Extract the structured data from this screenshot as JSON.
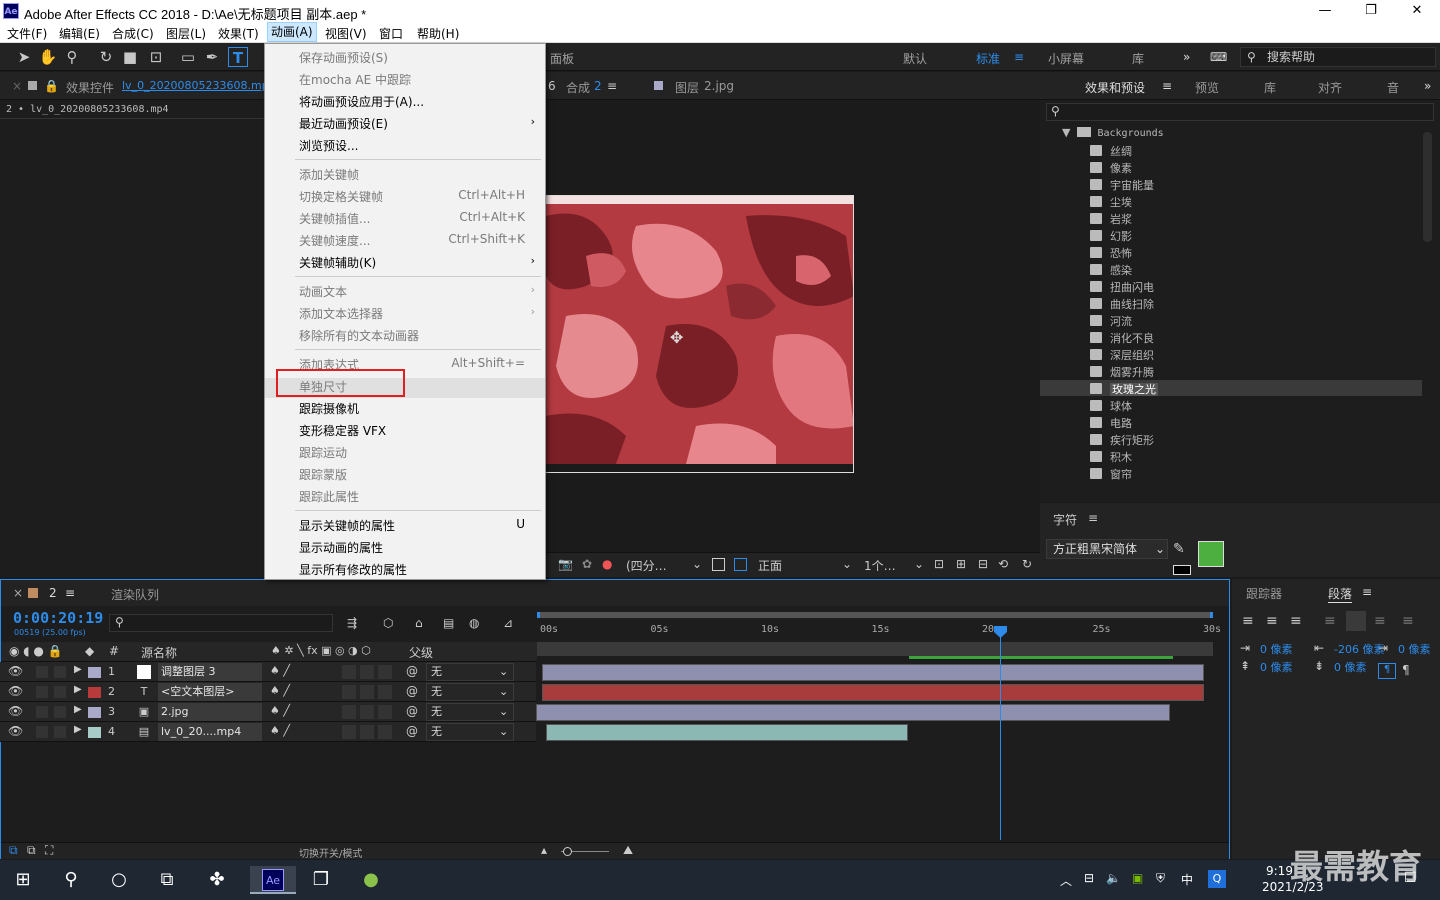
{
  "window": {
    "title": "Adobe After Effects CC 2018 - D:\\Ae\\无标题项目 副本.aep *",
    "app_icon": "Ae",
    "controls": [
      "—",
      "❐",
      "✕"
    ]
  },
  "menubar": {
    "items": [
      "文件(F)",
      "编辑(E)",
      "合成(C)",
      "图层(L)",
      "效果(T)",
      "动画(A)",
      "视图(V)",
      "窗口",
      "帮助(H)"
    ],
    "active": "动画(A)"
  },
  "toolbar": {
    "panel_label": "面板",
    "workspaces": [
      "默认",
      "标准",
      "小屏幕",
      "库"
    ],
    "active_workspace": "标准",
    "search_help": "搜索帮助"
  },
  "left_panel": {
    "tab_label": "效果控件",
    "tab_file": "lv_0_20200805233608.mp4",
    "subtitle": "2 • lv_0_20200805233608.mp4"
  },
  "viewer": {
    "tab_comp": "合成",
    "tab_comp_num": "2",
    "tab_layer": "图层",
    "tab_layer_file": "2.jpg",
    "bottom": {
      "resolution": "(四分…",
      "view": "正面",
      "views_count": "1个…"
    }
  },
  "animation_menu": {
    "items": [
      {
        "label": "保存动画预设(S)",
        "disabled": true
      },
      {
        "label": "在mocha AE 中跟踪",
        "disabled": true
      },
      {
        "label": "将动画预设应用于(A)...",
        "disabled": false
      },
      {
        "label": "最近动画预设(E)",
        "disabled": false,
        "submenu": true
      },
      {
        "label": "浏览预设...",
        "disabled": false
      },
      {
        "label": "添加关键帧",
        "disabled": true
      },
      {
        "label": "切换定格关键帧",
        "disabled": true,
        "shortcut": "Ctrl+Alt+H"
      },
      {
        "label": "关键帧插值...",
        "disabled": true,
        "shortcut": "Ctrl+Alt+K"
      },
      {
        "label": "关键帧速度...",
        "disabled": true,
        "shortcut": "Ctrl+Shift+K"
      },
      {
        "label": "关键帧辅助(K)",
        "disabled": false,
        "submenu": true
      },
      {
        "label": "动画文本",
        "disabled": true,
        "submenu": true
      },
      {
        "label": "添加文本选择器",
        "disabled": true,
        "submenu": true
      },
      {
        "label": "移除所有的文本动画器",
        "disabled": true
      },
      {
        "label": "添加表达式",
        "disabled": true,
        "shortcut": "Alt+Shift+="
      },
      {
        "label": "单独尺寸",
        "disabled": true,
        "highlighted": true
      },
      {
        "label": "跟踪摄像机",
        "disabled": false
      },
      {
        "label": "变形稳定器 VFX",
        "disabled": false
      },
      {
        "label": "跟踪运动",
        "disabled": true
      },
      {
        "label": "跟踪蒙版",
        "disabled": true
      },
      {
        "label": "跟踪此属性",
        "disabled": true
      },
      {
        "label": "显示关键帧的属性",
        "disabled": false,
        "shortcut": "U"
      },
      {
        "label": "显示动画的属性",
        "disabled": false
      },
      {
        "label": "显示所有修改的属性",
        "disabled": false
      }
    ]
  },
  "effects_panel": {
    "tabs": [
      "效果和预设",
      "预览",
      "库",
      "对齐",
      "音"
    ],
    "folder": "Backgrounds",
    "items": [
      "丝绸",
      "像素",
      "宇宙能量",
      "尘埃",
      "岩浆",
      "幻影",
      "恐怖",
      "感染",
      "扭曲闪电",
      "曲线扫除",
      "河流",
      "消化不良",
      "深层组织",
      "烟雾升腾",
      "玫瑰之光",
      "球体",
      "电路",
      "疾行矩形",
      "积木",
      "窗帘"
    ],
    "selected": "玫瑰之光"
  },
  "character_panel": {
    "title": "字符",
    "font": "方正粗黑宋简体",
    "fill_color": "#4caf3f"
  },
  "paragraph_panel": {
    "tabs": [
      "跟踪器",
      "段落"
    ],
    "values": [
      "0 像素",
      "-206 像素",
      "0 像素",
      "0 像素",
      "0 像素"
    ]
  },
  "timeline": {
    "tab_num": "2",
    "render_queue": "渲染队列",
    "timecode": "0:00:20:19",
    "frame_info": "00519 (25.00 fps)",
    "col_source": "源名称",
    "col_parent": "父级",
    "ruler": [
      "00s",
      "05s",
      "10s",
      "15s",
      "20s",
      "25s",
      "30s"
    ],
    "layers": [
      {
        "num": "1",
        "name": "调整图层 3",
        "parent": "无",
        "color": "#a9a9c9"
      },
      {
        "num": "2",
        "name": "<空文本图层>",
        "parent": "无",
        "color": "#b83a3a"
      },
      {
        "num": "3",
        "name": "2.jpg",
        "parent": "无",
        "color": "#a9a9c9"
      },
      {
        "num": "4",
        "name": "lv_0_20....mp4",
        "parent": "无",
        "color": "#a8cdc8"
      }
    ],
    "bottom_label": "切换开关/模式"
  },
  "taskbar": {
    "time": "9:19",
    "date": "2021/2/23",
    "ime": "中",
    "watermark": "最需教育"
  }
}
